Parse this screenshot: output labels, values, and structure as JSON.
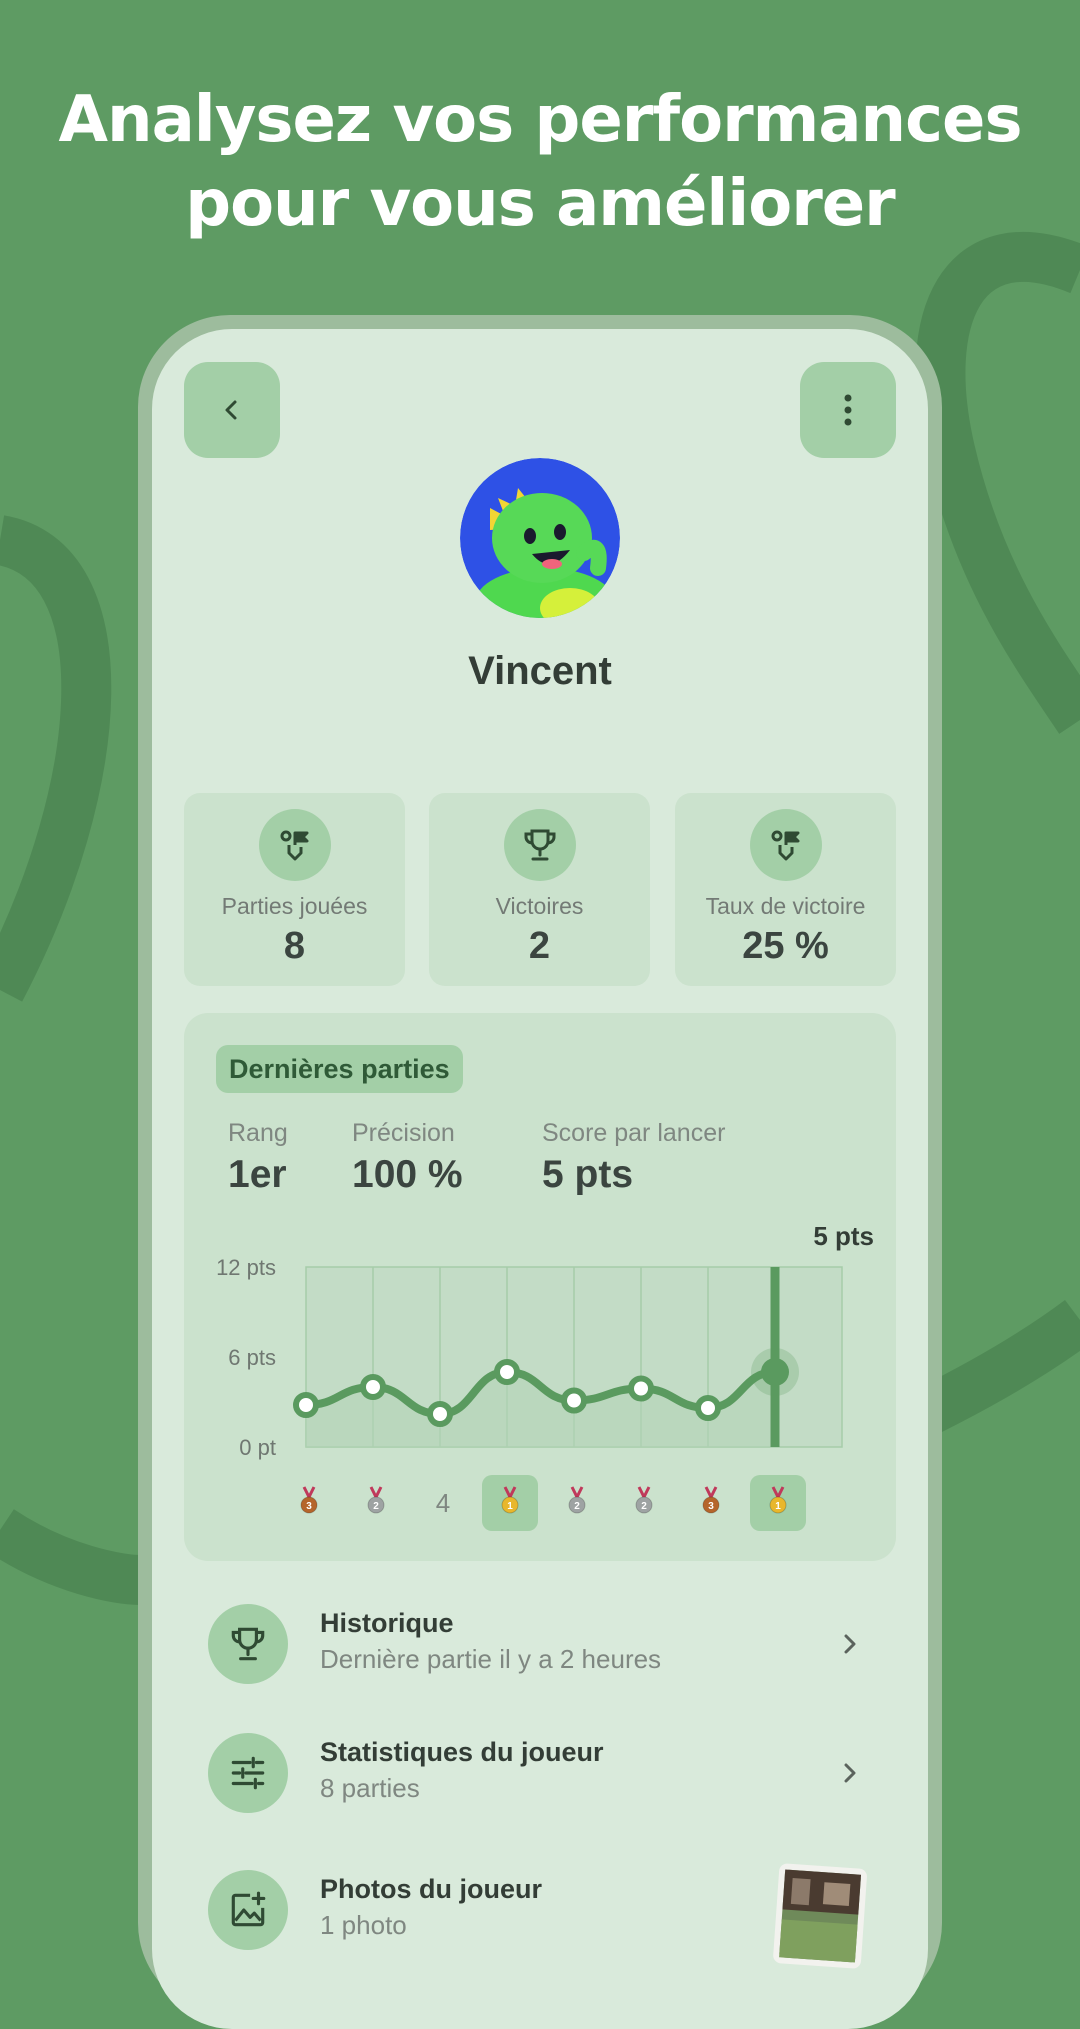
{
  "headline": {
    "line1": "Analysez vos performances",
    "line2": "pour vous améliorer"
  },
  "colors": {
    "background": "#5e9b63",
    "screen": "#d9eadb",
    "card": "#cbe2cd",
    "accent": "#a3cfa7",
    "chart_line": "#5a9a5f"
  },
  "player": {
    "name": "Vincent",
    "avatar": "green-dinosaur-avatar"
  },
  "header": {
    "back_icon": "chevron-left-icon",
    "menu_icon": "more-vertical-icon"
  },
  "stats": [
    {
      "icon": "dart-flag-icon",
      "label": "Parties jouées",
      "value": "8"
    },
    {
      "icon": "trophy-icon",
      "label": "Victoires",
      "value": "2"
    },
    {
      "icon": "dart-flag-icon",
      "label": "Taux de victoire",
      "value": "25 %"
    }
  ],
  "recent": {
    "title": "Dernières parties",
    "metrics": [
      {
        "label": "Rang",
        "value": "1er"
      },
      {
        "label": "Précision",
        "value": "100 %"
      },
      {
        "label": "Score par lancer",
        "value": "5 pts"
      }
    ]
  },
  "chart_data": {
    "type": "line",
    "x": [
      1,
      2,
      3,
      4,
      5,
      6,
      7,
      8
    ],
    "values": [
      2.8,
      4.0,
      2.2,
      5.0,
      3.1,
      3.9,
      2.6,
      5.0
    ],
    "ylim": [
      0,
      12
    ],
    "yticks": [
      "0 pt",
      "6 pts",
      "12 pts"
    ],
    "ytick_values": [
      0,
      6,
      12
    ],
    "highlight_label": "5 pts",
    "highlight_index": 7,
    "grid": true,
    "ranks": [
      {
        "type": "medal",
        "rank": 3,
        "color": "#b5652b",
        "highlight": false
      },
      {
        "type": "medal",
        "rank": 2,
        "color": "#9ea3a3",
        "highlight": false
      },
      {
        "type": "text",
        "text": "4",
        "highlight": false
      },
      {
        "type": "medal",
        "rank": 1,
        "color": "#e8b72c",
        "highlight": true
      },
      {
        "type": "medal",
        "rank": 2,
        "color": "#9ea3a3",
        "highlight": false
      },
      {
        "type": "medal",
        "rank": 2,
        "color": "#9ea3a3",
        "highlight": false
      },
      {
        "type": "medal",
        "rank": 3,
        "color": "#b5652b",
        "highlight": false
      },
      {
        "type": "medal",
        "rank": 1,
        "color": "#e8b72c",
        "highlight": true
      }
    ]
  },
  "menu": [
    {
      "icon": "trophy-icon",
      "title": "Historique",
      "subtitle": "Dernière partie il y a 2 heures",
      "trailing": "chevron-right-icon"
    },
    {
      "icon": "sliders-icon",
      "title": "Statistiques du joueur",
      "subtitle": "8 parties",
      "trailing": "chevron-right-icon"
    },
    {
      "icon": "add-photo-icon",
      "title": "Photos du joueur",
      "subtitle": "1 photo",
      "trailing": "photo-thumbnail"
    }
  ]
}
